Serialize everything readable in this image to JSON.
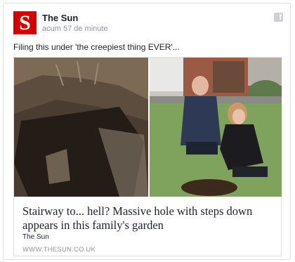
{
  "post": {
    "page_name": "The Sun",
    "timestamp": "acum 57 de minute",
    "caption": "Filing this under 'the creepiest thing EVER'...",
    "logo_letter": "S",
    "brand_color": "#d70000",
    "share_icon": "facebook-icon"
  },
  "link": {
    "headline": "Stairway to... hell? Massive hole with steps down appears in this family's garden",
    "source": "The Sun",
    "domain": "WWW.THESUN.CO.UK"
  }
}
